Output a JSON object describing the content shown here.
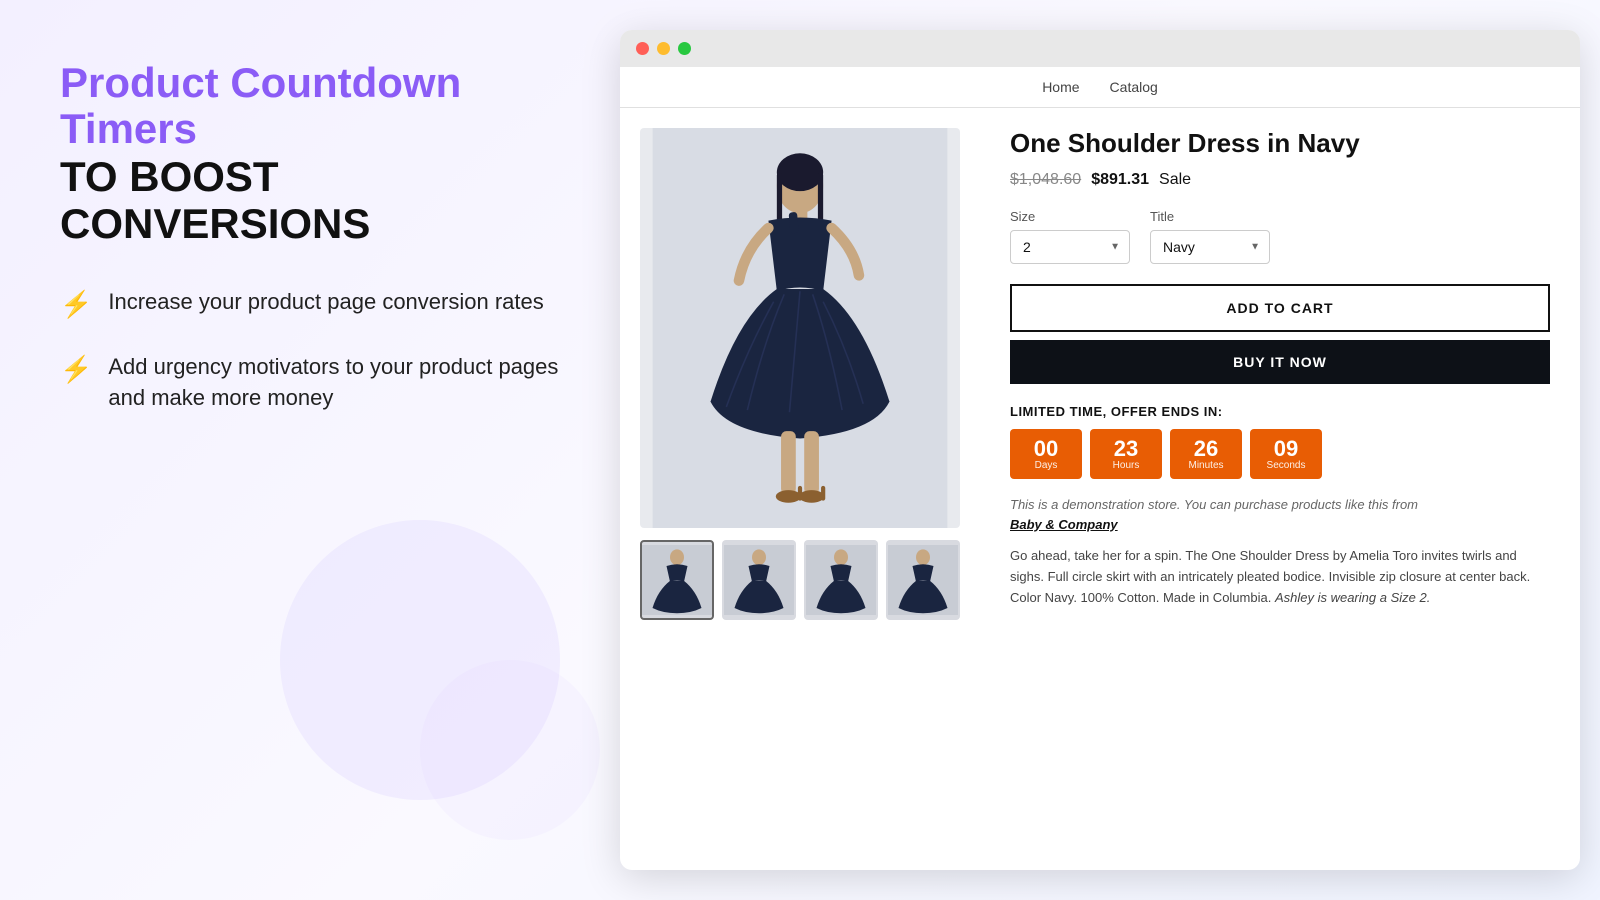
{
  "left": {
    "title_line1": "Product Countdown Timers",
    "title_line2": "TO BOOST CONVERSIONS",
    "features": [
      {
        "icon": "⚡",
        "text": "Increase your product page conversion rates"
      },
      {
        "icon": "⚡",
        "text": "Add urgency motivators to your product pages and make more money"
      }
    ]
  },
  "browser": {
    "nav_links": [
      "Home",
      "Catalog"
    ],
    "product": {
      "title": "One Shoulder Dress in Navy",
      "price_original": "$1,048.60",
      "price_sale": "$891.31",
      "price_sale_label": "Sale",
      "size_label": "Size",
      "size_value": "2",
      "title_label": "Title",
      "title_value": "Navy",
      "add_to_cart": "ADD TO CART",
      "buy_it_now": "BUY IT NOW",
      "countdown_title": "LIMITED TIME, OFFER ENDS IN:",
      "countdown": {
        "days": "00",
        "days_label": "Days",
        "hours": "23",
        "hours_label": "Hours",
        "minutes": "26",
        "minutes_label": "Minutes",
        "seconds": "09",
        "seconds_label": "Seconds"
      },
      "demo_text": "This is a demonstration store. You can purchase products like this from",
      "demo_link": "Baby & Company",
      "description": "Go ahead, take her for a spin. The One Shoulder Dress by Amelia Toro invites twirls and sighs. Full circle skirt with an intricately pleated bodice. Invisible zip closure at center back. Color Navy. 100% Cotton. Made in Columbia.",
      "description_italic": "Ashley is wearing a Size 2."
    },
    "thumbnails": [
      {
        "label": "thumb-1"
      },
      {
        "label": "thumb-2"
      },
      {
        "label": "thumb-3"
      },
      {
        "label": "thumb-4"
      }
    ]
  },
  "colors": {
    "accent_purple": "#8b5cf6",
    "countdown_bg": "#e85d04",
    "buy_now_bg": "#0d1117"
  }
}
